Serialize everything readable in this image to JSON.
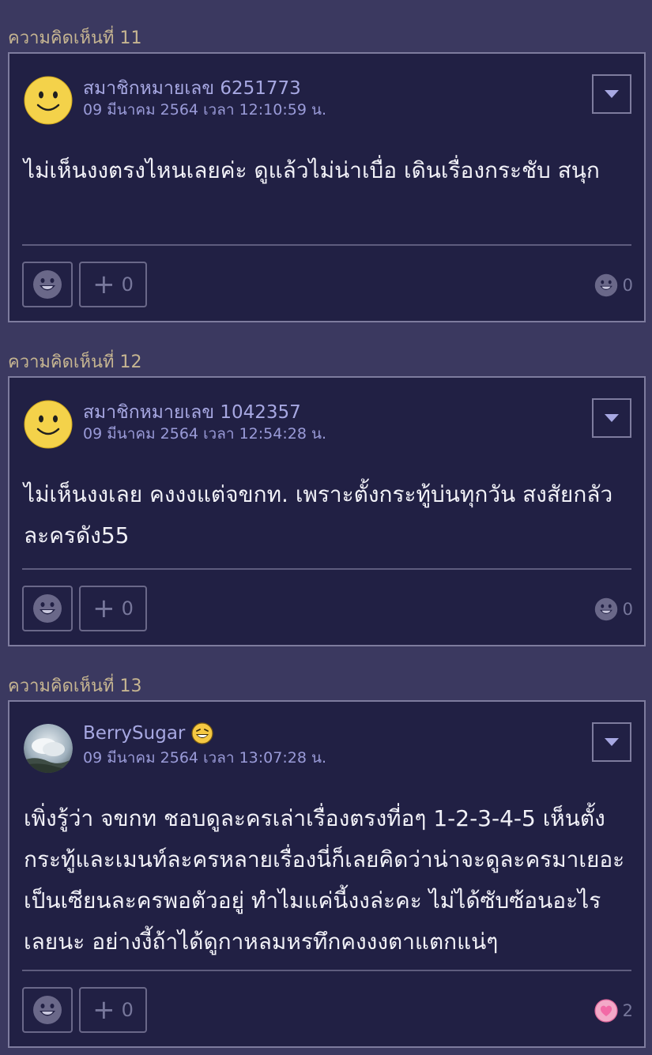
{
  "comments": [
    {
      "heading": "ความคิดเห็นที่ 11",
      "username": "สมาชิกหมายเลข 6251773",
      "timestamp": "09 มีนาคม 2564 เวลา 12:10:59 น.",
      "text": "ไม่เห็นงงตรงไหนเลยค่ะ ดูแล้วไม่น่าเบื่อ เดินเรื่องกระชับ สนุก",
      "plus_count": "0",
      "reaction_count": "0",
      "avatar_icon": "smiley-icon",
      "reaction_icon": "grin-icon"
    },
    {
      "heading": "ความคิดเห็นที่ 12",
      "username": "สมาชิกหมายเลข 1042357",
      "timestamp": "09 มีนาคม 2564 เวลา 12:54:28 น.",
      "text": "ไม่เห็นงงเลย คงงงแต่จขกท. เพราะตั้งกระทู้บ่นทุกวัน สงสัยกลัวละครดัง55",
      "plus_count": "0",
      "reaction_count": "0",
      "avatar_icon": "smiley-icon",
      "reaction_icon": "grin-icon"
    },
    {
      "heading": "ความคิดเห็นที่ 13",
      "username": "BerrySugar",
      "timestamp": "09 มีนาคม 2564 เวลา 13:07:28 น.",
      "text": "เพิ่งรู้ว่า จขกท ชอบดูละครเล่าเรื่องตรงที่อๆ 1-2-3-4-5 เห็นตั้งกระทู้และเมนท์ละครหลายเรื่องนี่ก็เลยคิดว่าน่าจะดูละครมาเยอะ เป็นเซียนละครพอตัวอยู่ ทำไมแค่นี้งงล่ะคะ ไม่ได้ซับซ้อนอะไรเลยนะ อย่างงี้ถ้าได้ดูกาหลมหรทึกคงงงตาแตกแน่ๆ",
      "plus_count": "0",
      "reaction_count": "2",
      "avatar_icon": "cloud-photo-avatar",
      "reaction_icon": "heart-icon",
      "badge_icon": "laughing-emoji-icon"
    }
  ],
  "colors": {
    "background": "#3b3960",
    "card": "#212044",
    "heading": "#c6b591",
    "username": "#a7a8e2",
    "text": "#f1f1f7",
    "heart": "#f26aa6"
  }
}
